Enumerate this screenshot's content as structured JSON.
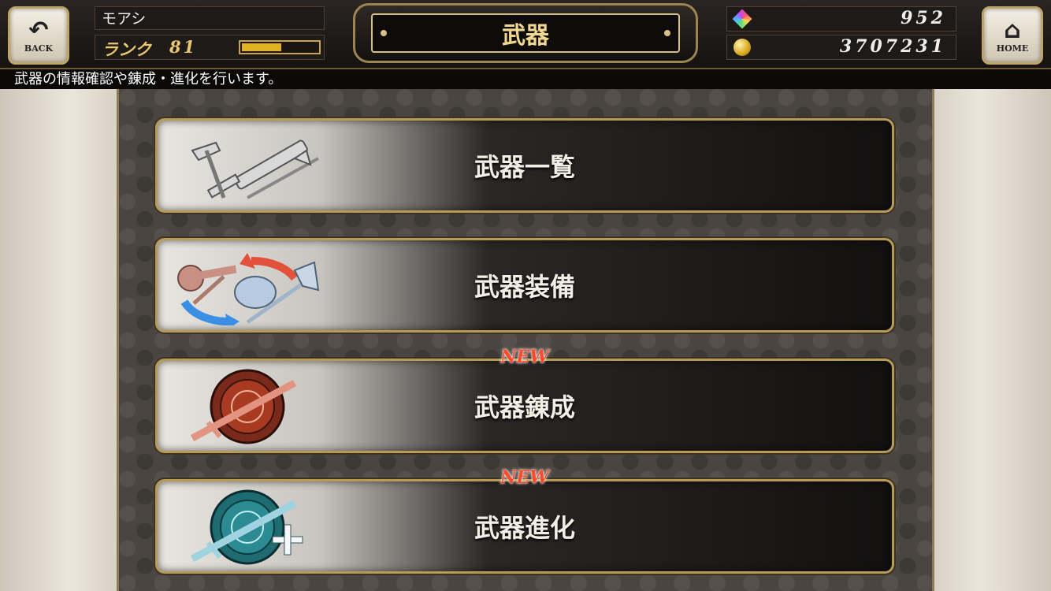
{
  "header": {
    "back_label": "BACK",
    "home_label": "HOME",
    "player_name": "モアシ",
    "rank_label": "ランク",
    "rank_value": "81",
    "rank_progress": 0.5,
    "title": "武器",
    "gems": "952",
    "gil": "3707231"
  },
  "info_text": "武器の情報確認や錬成・進化を行います。",
  "menu": [
    {
      "label": "武器一覧",
      "badge": ""
    },
    {
      "label": "武器装備",
      "badge": ""
    },
    {
      "label": "武器錬成",
      "badge": "NEW"
    },
    {
      "label": "武器進化",
      "badge": "NEW"
    }
  ],
  "icons": {
    "back": "back-arrow-icon",
    "home": "house-icon",
    "gem": "rainbow-crystal-icon",
    "gil": "gold-coin-icon",
    "list": "weapons-collection-icon",
    "equip": "weapons-swap-icon",
    "refine": "red-sword-emblem-icon",
    "evolve": "blue-sword-plus-icon"
  },
  "colors": {
    "accent_gold": "#e9c770",
    "new_badge": "#ff4b2b",
    "frame_gold": "#b79a55"
  }
}
